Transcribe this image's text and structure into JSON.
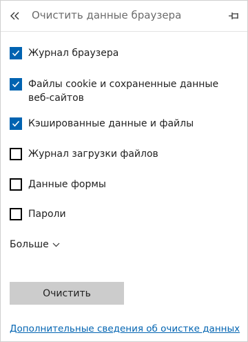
{
  "header": {
    "title": "Очистить данные браузера",
    "back_icon": "double-chevron-left-icon",
    "pin_icon": "pin-icon"
  },
  "options": [
    {
      "label": "Журнал браузера",
      "checked": true
    },
    {
      "label": "Файлы cookie и сохраненные данные веб-сайтов",
      "checked": true
    },
    {
      "label": "Кэшированные данные и файлы",
      "checked": true
    },
    {
      "label": "Журнал загрузки файлов",
      "checked": false
    },
    {
      "label": "Данные формы",
      "checked": false
    },
    {
      "label": "Пароли",
      "checked": false
    }
  ],
  "more": {
    "label": "Больше",
    "icon": "chevron-down-icon"
  },
  "clear_button": {
    "label": "Очистить"
  },
  "more_info_link": {
    "label": "Дополнительные сведения об очистке данных"
  },
  "colors": {
    "accent": "#0063b1",
    "button_bg": "#cccccc",
    "title_text": "#6b6b6b"
  }
}
